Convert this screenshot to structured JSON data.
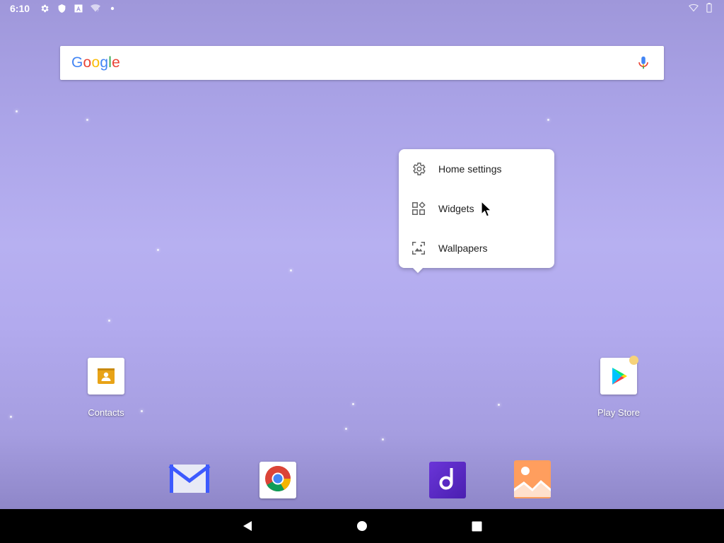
{
  "status_bar": {
    "time": "6:10",
    "icons_left": [
      "settings-icon",
      "shield-icon",
      "a-icon",
      "wifi-question-icon",
      "dot-icon"
    ],
    "icons_right": [
      "wifi-icon",
      "battery-icon"
    ]
  },
  "search": {
    "logo_letters": [
      {
        "ch": "G",
        "color": "#4285F4"
      },
      {
        "ch": "o",
        "color": "#EA4335"
      },
      {
        "ch": "o",
        "color": "#FBBC05"
      },
      {
        "ch": "g",
        "color": "#4285F4"
      },
      {
        "ch": "l",
        "color": "#34A853"
      },
      {
        "ch": "e",
        "color": "#EA4335"
      }
    ],
    "mic_icon": "mic-icon"
  },
  "context_menu": {
    "items": [
      {
        "label": "Home settings",
        "icon": "gear-icon"
      },
      {
        "label": "Widgets",
        "icon": "widgets-icon"
      },
      {
        "label": "Wallpapers",
        "icon": "wallpaper-icon"
      }
    ]
  },
  "desktop_apps": [
    {
      "label": "Contacts",
      "icon": "contacts-icon"
    },
    {
      "label": "Play Store",
      "icon": "play-store-icon",
      "has_notification": true
    }
  ],
  "dock": [
    {
      "name": "Email",
      "icon": "email-icon"
    },
    {
      "name": "Chrome",
      "icon": "chrome-icon"
    },
    {
      "name": "Music",
      "icon": "music-icon"
    },
    {
      "name": "Gallery",
      "icon": "gallery-icon"
    }
  ],
  "nav_bar": {
    "buttons": [
      "back-icon",
      "home-icon",
      "recents-icon"
    ]
  },
  "colors": {
    "wallpaper_top": "#9f97da",
    "wallpaper_mid": "#b7b0f1",
    "notification_dot": "#f6d27a"
  }
}
